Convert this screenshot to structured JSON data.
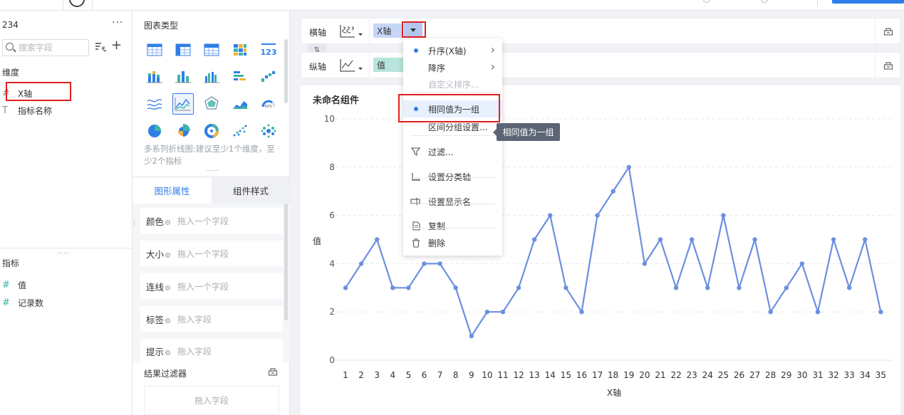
{
  "dataset": {
    "name": "234",
    "more": "···"
  },
  "search": {
    "placeholder": "搜索字段",
    "value": ""
  },
  "fields": {
    "dimension_title": "维度",
    "dimensions": [
      {
        "label": "X轴",
        "icon": "hash-icon",
        "glyph": "#"
      },
      {
        "label": "指标名称",
        "icon": "text-type-icon",
        "glyph": "T"
      }
    ],
    "measure_title": "指标",
    "measures": [
      {
        "label": "值",
        "icon": "hash-icon",
        "glyph": "#"
      },
      {
        "label": "记录数",
        "icon": "hash-icon",
        "glyph": "#"
      }
    ]
  },
  "chart_types": {
    "title": "图表类型",
    "selected": "multi-series-line",
    "hint": "多系列折线图:建议至少1个维度，至少2个指标",
    "items": [
      "table",
      "cross-table",
      "detail-table",
      "heat-table",
      "kpi-number",
      "stacked-bar",
      "grouped-bar",
      "multi-bar",
      "range-bar",
      "waterfall",
      "area-lines",
      "multi-series-line",
      "radar",
      "stacked-area",
      "gauge",
      "pie",
      "rose-pie",
      "ring",
      "scatter",
      "bubble"
    ]
  },
  "attr_tabs": {
    "active": "图形属性",
    "inactive": "组件样式"
  },
  "attrs": [
    {
      "label": "颜色",
      "placeholder": "拖入一个字段"
    },
    {
      "label": "大小",
      "placeholder": "拖入一个字段"
    },
    {
      "label": "连线",
      "placeholder": "拖入一个字段"
    },
    {
      "label": "标签",
      "placeholder": "拖入字段"
    },
    {
      "label": "提示",
      "placeholder": "拖入字段"
    }
  ],
  "result_filter": {
    "title": "结果过滤器",
    "placeholder": "拖入字段"
  },
  "axes": {
    "x": {
      "label": "横轴",
      "field": "X轴"
    },
    "y": {
      "label": "纵轴",
      "field": "值"
    }
  },
  "menu": {
    "items": [
      {
        "label": "升序(X轴)",
        "type": "bullet",
        "submenu": true
      },
      {
        "label": "降序",
        "type": "none",
        "submenu": true
      },
      {
        "label": "自定义排序...",
        "type": "none",
        "disabled": true
      },
      {
        "label": "相同值为一组",
        "type": "bullet",
        "hover": true
      },
      {
        "label": "区间分组设置...",
        "type": "none"
      },
      {
        "label": "过滤...",
        "type": "filter-icon"
      },
      {
        "label": "设置分类轴",
        "type": "axis-icon"
      },
      {
        "label": "设置显示名",
        "type": "rename-icon"
      },
      {
        "label": "复制",
        "type": "copy-icon"
      },
      {
        "label": "删除",
        "type": "trash-icon"
      }
    ]
  },
  "tooltip": "相同值为一组",
  "chart_title": "未命名组件",
  "chart_data": {
    "type": "line",
    "xlabel": "X轴",
    "ylabel": "值",
    "ylim": [
      0,
      10
    ],
    "yticks": [
      0,
      2,
      4,
      6,
      8,
      10
    ],
    "x": [
      1,
      2,
      3,
      4,
      5,
      6,
      7,
      8,
      9,
      10,
      11,
      12,
      13,
      14,
      15,
      16,
      17,
      18,
      19,
      20,
      21,
      22,
      23,
      24,
      25,
      26,
      27,
      28,
      29,
      30,
      31,
      32,
      33,
      34,
      35
    ],
    "series": [
      {
        "values": [
          3,
          4,
          5,
          3,
          3,
          4,
          4,
          3,
          1,
          2,
          2,
          3,
          5,
          6,
          3,
          2,
          6,
          7,
          8,
          4,
          5,
          3,
          5,
          3,
          6,
          3,
          5,
          2,
          3,
          4,
          2,
          5,
          3,
          5,
          2
        ]
      }
    ],
    "color": "#6c8fe0",
    "grid": "horizontal-dashed"
  }
}
